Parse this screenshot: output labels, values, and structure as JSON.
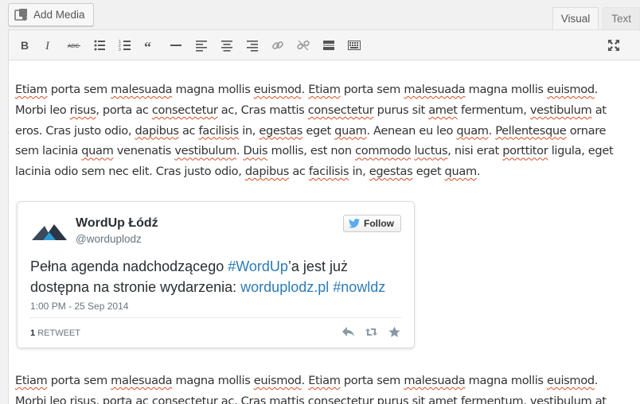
{
  "topbar": {
    "add_media_label": "Add Media",
    "tabs": [
      {
        "label": "Visual",
        "active": true
      },
      {
        "label": "Text",
        "active": false
      }
    ]
  },
  "toolbar": {
    "buttons": [
      "bold-icon",
      "italic-icon",
      "strikethrough-icon",
      "bullet-list-icon",
      "numbered-list-icon",
      "blockquote-icon",
      "horizontal-rule-icon",
      "align-left-icon",
      "align-center-icon",
      "align-right-icon",
      "insert-link-icon",
      "unlink-icon",
      "read-more-icon",
      "toolbar-toggle-icon"
    ],
    "fullscreen_icon": "fullscreen-icon"
  },
  "content": {
    "paragraph1": [
      {
        "t": "Etiam",
        "s": true
      },
      {
        "t": " porta sem ",
        "s": false
      },
      {
        "t": "malesuada",
        "s": true
      },
      {
        "t": " magna mollis ",
        "s": false
      },
      {
        "t": "euismod",
        "s": true
      },
      {
        "t": ". ",
        "s": false
      },
      {
        "t": "Etiam",
        "s": true
      },
      {
        "t": " porta sem ",
        "s": false
      },
      {
        "t": "malesuada",
        "s": true
      },
      {
        "t": " magna mollis ",
        "s": false
      },
      {
        "t": "euismod",
        "s": true
      },
      {
        "t": ". Morbi leo ",
        "s": false
      },
      {
        "t": "risus",
        "s": true
      },
      {
        "t": ", porta ac ",
        "s": false
      },
      {
        "t": "consectetur",
        "s": true
      },
      {
        "t": " ac, Cras mattis ",
        "s": false
      },
      {
        "t": "consectetur",
        "s": true
      },
      {
        "t": " purus sit ",
        "s": false
      },
      {
        "t": "amet",
        "s": true
      },
      {
        "t": " fermentum, ",
        "s": false
      },
      {
        "t": "vestibulum",
        "s": true
      },
      {
        "t": " at eros. Cras justo odio, ",
        "s": false
      },
      {
        "t": "dapibus",
        "s": true
      },
      {
        "t": " ac ",
        "s": false
      },
      {
        "t": "facilisis",
        "s": true
      },
      {
        "t": " in, ",
        "s": false
      },
      {
        "t": "egestas",
        "s": true
      },
      {
        "t": " eget ",
        "s": false
      },
      {
        "t": "quam",
        "s": true
      },
      {
        "t": ". Aenean eu leo ",
        "s": false
      },
      {
        "t": "quam",
        "s": true
      },
      {
        "t": ". ",
        "s": false
      },
      {
        "t": "Pellentesque",
        "s": true
      },
      {
        "t": " ornare sem lacinia ",
        "s": false
      },
      {
        "t": "quam",
        "s": true
      },
      {
        "t": " venenatis ",
        "s": false
      },
      {
        "t": "vestibulum",
        "s": true
      },
      {
        "t": ". ",
        "s": false
      },
      {
        "t": "Duis",
        "s": true
      },
      {
        "t": " mollis, est non ",
        "s": false
      },
      {
        "t": "commodo",
        "s": true
      },
      {
        "t": " ",
        "s": false
      },
      {
        "t": "luctus",
        "s": true
      },
      {
        "t": ", nisi erat ",
        "s": false
      },
      {
        "t": "porttitor",
        "s": true
      },
      {
        "t": " ligula, eget lacinia odio sem nec elit. Cras justo odio, ",
        "s": false
      },
      {
        "t": "dapibus",
        "s": true
      },
      {
        "t": " ac ",
        "s": false
      },
      {
        "t": "facilisis",
        "s": true
      },
      {
        "t": " in, ",
        "s": false
      },
      {
        "t": "egestas",
        "s": true
      },
      {
        "t": " eget ",
        "s": false
      },
      {
        "t": "quam",
        "s": true
      },
      {
        "t": ".",
        "s": false
      }
    ],
    "paragraph2": [
      {
        "t": "Etiam",
        "s": true
      },
      {
        "t": " porta sem ",
        "s": false
      },
      {
        "t": "malesuada",
        "s": true
      },
      {
        "t": " magna mollis ",
        "s": false
      },
      {
        "t": "euismod",
        "s": true
      },
      {
        "t": ". ",
        "s": false
      },
      {
        "t": "Etiam",
        "s": true
      },
      {
        "t": " porta sem ",
        "s": false
      },
      {
        "t": "malesuada",
        "s": true
      },
      {
        "t": " magna mollis ",
        "s": false
      },
      {
        "t": "euismod",
        "s": true
      },
      {
        "t": ". Morbi leo ",
        "s": false
      },
      {
        "t": "risus",
        "s": true
      },
      {
        "t": ", porta ac ",
        "s": false
      },
      {
        "t": "consectetur",
        "s": true
      },
      {
        "t": " ac, Cras mattis ",
        "s": false
      },
      {
        "t": "consectetur",
        "s": true
      },
      {
        "t": " purus sit ",
        "s": false
      },
      {
        "t": "amet",
        "s": true
      },
      {
        "t": " fermentum, ",
        "s": false
      },
      {
        "t": "vestibulum",
        "s": true
      },
      {
        "t": " at",
        "s": false
      }
    ]
  },
  "tweet": {
    "name": "WordUp Łódź",
    "handle": "@worduplodz",
    "follow_label": "Follow",
    "text_plain": "Pełna agenda nadchodzącego ",
    "hashtag1": "#WordUp",
    "text_mid": "’a jest już dostępna na stronie wydarzenia: ",
    "link": "worduplodz.pl",
    "hashtag2": "#nowldz",
    "timestamp": "1:00 PM - 25 Sep 2014",
    "retweet_count": "1",
    "retweet_label": "RETWEET",
    "link_color": "#2b7bb9"
  },
  "colors": {
    "spellcheck_underline": "#d54e21"
  }
}
